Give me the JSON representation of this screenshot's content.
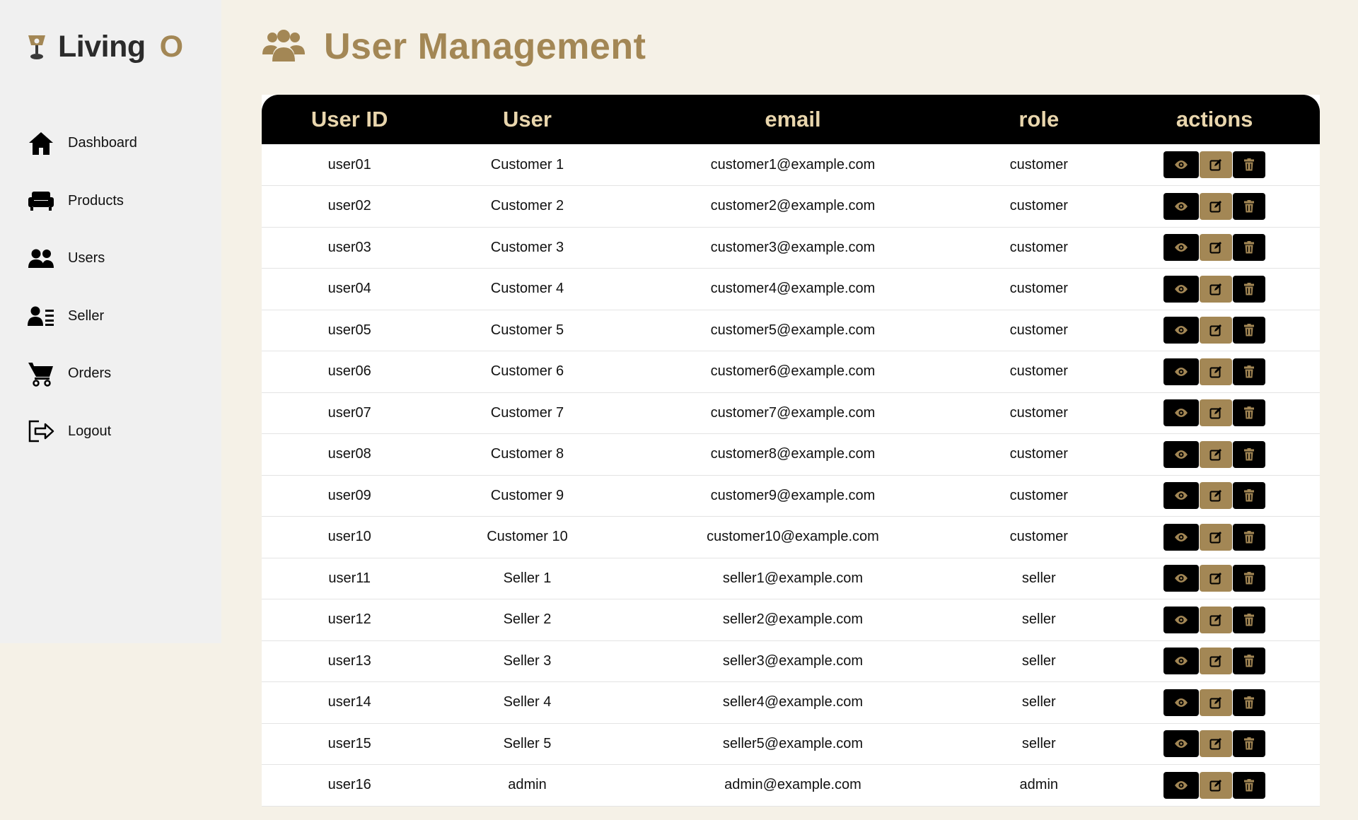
{
  "brand": {
    "name": "Living",
    "suffix": "O"
  },
  "sidebar": {
    "items": [
      {
        "label": "Dashboard",
        "icon": "home-icon"
      },
      {
        "label": "Products",
        "icon": "couch-icon"
      },
      {
        "label": "Users",
        "icon": "users-icon"
      },
      {
        "label": "Seller",
        "icon": "id-card-icon"
      },
      {
        "label": "Orders",
        "icon": "cart-icon"
      },
      {
        "label": "Logout",
        "icon": "logout-icon"
      }
    ]
  },
  "page": {
    "title": "User Management",
    "icon": "users-icon"
  },
  "table": {
    "columns": [
      "User ID",
      "User",
      "email",
      "role",
      "actions"
    ],
    "rows": [
      {
        "id": "user01",
        "user": "Customer 1",
        "email": "customer1@example.com",
        "role": "customer"
      },
      {
        "id": "user02",
        "user": "Customer 2",
        "email": "customer2@example.com",
        "role": "customer"
      },
      {
        "id": "user03",
        "user": "Customer 3",
        "email": "customer3@example.com",
        "role": "customer"
      },
      {
        "id": "user04",
        "user": "Customer 4",
        "email": "customer4@example.com",
        "role": "customer"
      },
      {
        "id": "user05",
        "user": "Customer 5",
        "email": "customer5@example.com",
        "role": "customer"
      },
      {
        "id": "user06",
        "user": "Customer 6",
        "email": "customer6@example.com",
        "role": "customer"
      },
      {
        "id": "user07",
        "user": "Customer 7",
        "email": "customer7@example.com",
        "role": "customer"
      },
      {
        "id": "user08",
        "user": "Customer 8",
        "email": "customer8@example.com",
        "role": "customer"
      },
      {
        "id": "user09",
        "user": "Customer 9",
        "email": "customer9@example.com",
        "role": "customer"
      },
      {
        "id": "user10",
        "user": "Customer 10",
        "email": "customer10@example.com",
        "role": "customer"
      },
      {
        "id": "user11",
        "user": "Seller 1",
        "email": "seller1@example.com",
        "role": "seller"
      },
      {
        "id": "user12",
        "user": "Seller 2",
        "email": "seller2@example.com",
        "role": "seller"
      },
      {
        "id": "user13",
        "user": "Seller 3",
        "email": "seller3@example.com",
        "role": "seller"
      },
      {
        "id": "user14",
        "user": "Seller 4",
        "email": "seller4@example.com",
        "role": "seller"
      },
      {
        "id": "user15",
        "user": "Seller 5",
        "email": "seller5@example.com",
        "role": "seller"
      },
      {
        "id": "user16",
        "user": "admin",
        "email": "admin@example.com",
        "role": "admin"
      }
    ],
    "actions": [
      {
        "name": "view-button",
        "icon": "eye-icon"
      },
      {
        "name": "edit-button",
        "icon": "edit-icon"
      },
      {
        "name": "delete-button",
        "icon": "trash-icon"
      }
    ]
  },
  "colors": {
    "accent": "#a38755",
    "background": "#f5f1e7",
    "sidebar": "#f0f0f0",
    "header_bg": "#000000",
    "header_text": "#e9d6ad"
  }
}
